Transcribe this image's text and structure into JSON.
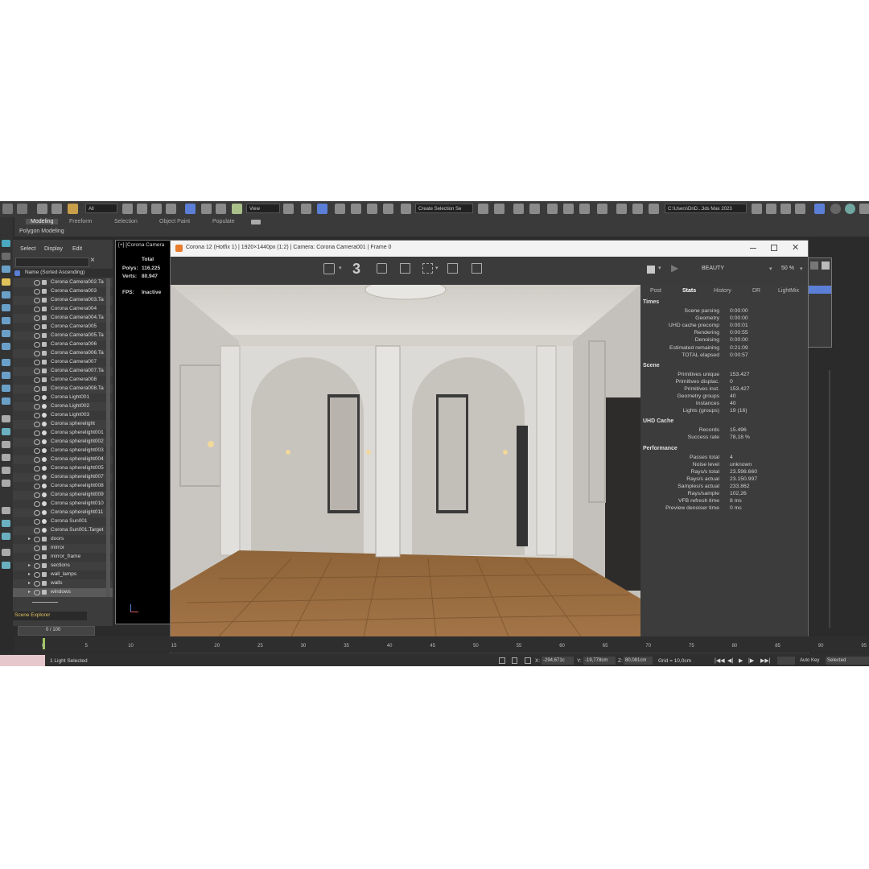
{
  "toolbar": {
    "selection_filter": "All",
    "ref_coord": "View",
    "named_selection": "Create Selection Se",
    "project_path": "C:\\Users\\DnD...3ds Max 2023"
  },
  "ribbon": {
    "tabs": [
      "Modeling",
      "Freeform",
      "Selection",
      "Object Paint",
      "Populate"
    ],
    "sub_label": "Polygon Modeling"
  },
  "scene_explorer": {
    "menu": [
      "Select",
      "Display",
      "Edit"
    ],
    "column_header": "Name (Sorted Ascending)",
    "items": [
      {
        "name": "Corona Camera002.Ta",
        "type": "camera"
      },
      {
        "name": "Corona Camera003",
        "type": "camera"
      },
      {
        "name": "Corona Camera003.Ta",
        "type": "camera"
      },
      {
        "name": "Corona Camera004",
        "type": "camera"
      },
      {
        "name": "Corona Camera004.Ta",
        "type": "camera"
      },
      {
        "name": "Corona Camera005",
        "type": "camera"
      },
      {
        "name": "Corona Camera005.Ta",
        "type": "camera"
      },
      {
        "name": "Corona Camera006",
        "type": "camera"
      },
      {
        "name": "Corona Camera006.Ta",
        "type": "camera"
      },
      {
        "name": "Corona Camera007",
        "type": "camera"
      },
      {
        "name": "Corona Camera007.Ta",
        "type": "camera"
      },
      {
        "name": "Corona Camera008",
        "type": "camera"
      },
      {
        "name": "Corona Camera008.Ta",
        "type": "camera"
      },
      {
        "name": "Corona Light001",
        "type": "light"
      },
      {
        "name": "Corona Light002",
        "type": "light"
      },
      {
        "name": "Corona Light003",
        "type": "light"
      },
      {
        "name": "Corona spherelight",
        "type": "light"
      },
      {
        "name": "Corona spherelight001",
        "type": "light"
      },
      {
        "name": "Corona spherelight002",
        "type": "light"
      },
      {
        "name": "Corona spherelight003",
        "type": "light"
      },
      {
        "name": "Corona spherelight004",
        "type": "light"
      },
      {
        "name": "Corona spherelight005",
        "type": "light"
      },
      {
        "name": "Corona spherelight007",
        "type": "light"
      },
      {
        "name": "Corona spherelight008",
        "type": "light"
      },
      {
        "name": "Corona spherelight009",
        "type": "light"
      },
      {
        "name": "Corona spherelight010",
        "type": "light"
      },
      {
        "name": "Corona spherelight011",
        "type": "light"
      },
      {
        "name": "Corona Sun001",
        "type": "light"
      },
      {
        "name": "Corona Sun001.Target",
        "type": "light"
      },
      {
        "name": "doors",
        "type": "layer"
      },
      {
        "name": "mirror",
        "type": "object"
      },
      {
        "name": "mirror_frame",
        "type": "object"
      },
      {
        "name": "sections",
        "type": "layer"
      },
      {
        "name": "wall_lamps",
        "type": "layer"
      },
      {
        "name": "walls",
        "type": "layer"
      },
      {
        "name": "windows",
        "type": "layer"
      }
    ],
    "footer_label": "Scene Explorer",
    "frame_counter": "0 / 100"
  },
  "viewport": {
    "label": "[+] [Corona Camera",
    "total_label": "Total",
    "polys_label": "Polys:",
    "polys_value": "116.225",
    "verts_label": "Verts:",
    "verts_value": "80.947",
    "fps_label": "FPS:",
    "fps_value": "Inactive"
  },
  "vfb": {
    "title": "Corona 12 (Hotfix 1) | 1920×1440px (1:2) | Camera: Corona Camera001 | Frame 0",
    "pass_number": "3",
    "channel": "BEAUTY",
    "zoom": "50 %",
    "tabs": [
      "Post",
      "Stats",
      "History",
      "DR",
      "LightMix"
    ],
    "active_tab": "Stats",
    "sections": [
      {
        "title": "Times",
        "rows": [
          {
            "label": "Scene parsing",
            "value": "0:00:00"
          },
          {
            "label": "Geometry",
            "value": "0:00:00"
          },
          {
            "label": "UHD cache precomp",
            "value": "0:00:01"
          },
          {
            "label": "Rendering",
            "value": "0:00:55"
          },
          {
            "label": "Denoising",
            "value": "0:00:00"
          },
          {
            "label": "Estimated remaining",
            "value": "0:21:09"
          },
          {
            "label": "TOTAL elapsed",
            "value": "0:00:57"
          }
        ]
      },
      {
        "title": "Scene",
        "rows": [
          {
            "label": "Primitives unique",
            "value": "153.427"
          },
          {
            "label": "Primitives displac.",
            "value": "0"
          },
          {
            "label": "Primitives inst.",
            "value": "153.427"
          },
          {
            "label": "Geometry groups",
            "value": "40"
          },
          {
            "label": "Instances",
            "value": "40"
          },
          {
            "label": "Lights (groups)",
            "value": "19 (16)"
          }
        ]
      },
      {
        "title": "UHD Cache",
        "rows": [
          {
            "label": "Records",
            "value": "15.496"
          },
          {
            "label": "Success rate",
            "value": "78,18 %"
          }
        ]
      },
      {
        "title": "Performance",
        "rows": [
          {
            "label": "Passes total",
            "value": "4"
          },
          {
            "label": "Noise level",
            "value": "unknown"
          },
          {
            "label": "Rays/s total",
            "value": "23.598.660"
          },
          {
            "label": "Rays/s actual",
            "value": "23.150.997"
          },
          {
            "label": "Samples/s actual",
            "value": "233.862"
          },
          {
            "label": "Rays/sample",
            "value": "102,26"
          },
          {
            "label": "VFB refresh time",
            "value": "8 ms"
          },
          {
            "label": "Preview denoiser time",
            "value": "0 ms"
          }
        ]
      }
    ]
  },
  "timeline": {
    "ticks": [
      "0",
      "5",
      "10",
      "15",
      "20",
      "25",
      "30",
      "35",
      "40",
      "45",
      "50",
      "55",
      "60",
      "65",
      "70",
      "75",
      "80",
      "85",
      "90",
      "95"
    ]
  },
  "status": {
    "selection": "1 Light Selected",
    "x_label": "X:",
    "x_value": "-294,671c",
    "y_label": "Y:",
    "y_value": "-19,778cm",
    "z_label": "Z:",
    "z_value": "80,081cm",
    "grid": "Grid = 10,0cm",
    "auto_key": "Auto Key",
    "key_filter": "Selected"
  },
  "colors": {
    "app_bg": "#2b2b2b",
    "selection_blue": "#5b7fd6",
    "floor_wood": "#9a6b3f",
    "wall_white": "#dcdad6"
  }
}
